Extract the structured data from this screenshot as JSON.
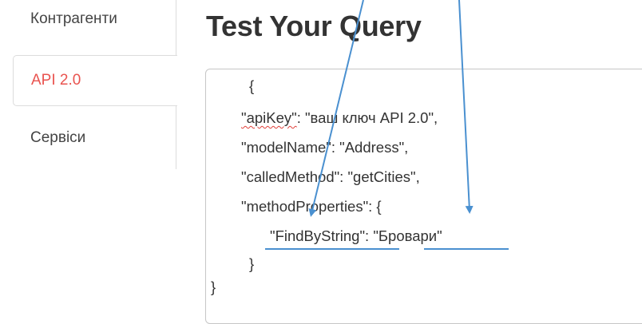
{
  "sidebar": {
    "items": [
      {
        "label": "Контрагенти",
        "active": false
      },
      {
        "label": "API 2.0",
        "active": true
      },
      {
        "label": "Сервіси",
        "active": false
      }
    ]
  },
  "main": {
    "title": "Test Your Query",
    "code": {
      "open_inner": "{",
      "apikey_key": "\"apiKey\"",
      "apikey_value": ": \"ваш ключ API 2.0\",",
      "model_line": "\"modelName\": \"Address\",",
      "method_line": "\"calledMethod\": \"getCities\",",
      "props_line": "\"methodProperties\": {",
      "find_key": "\"FindByString\"",
      "sep": ": ",
      "find_value": "\"Бровари\"",
      "close_inner": "}",
      "close_outer": "}"
    }
  },
  "colors": {
    "active_tab": "#e9534f",
    "annotation": "#4a90d0",
    "spellcheck": "#e0403a"
  }
}
